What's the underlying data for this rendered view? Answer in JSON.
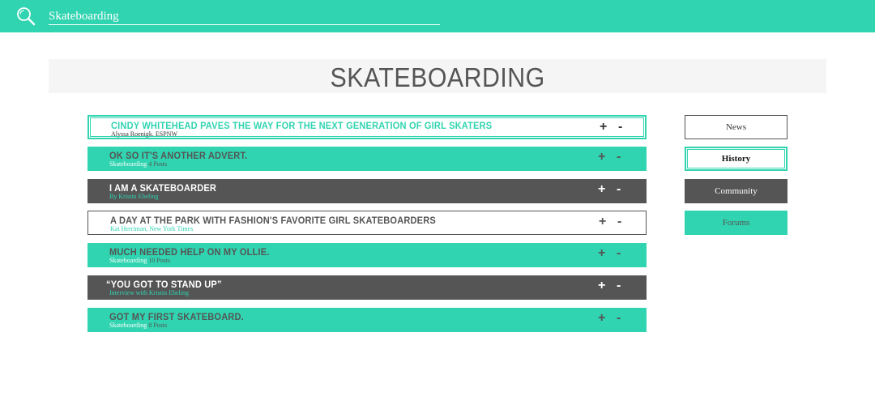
{
  "search": {
    "value": "Skateboarding"
  },
  "page": {
    "title": "SKATEBOARDING"
  },
  "feed": [
    {
      "title": "CINDY WHITEHEAD PAVES THE WAY FOR THE NEXT GENERATION OF GIRL SKATERS",
      "sub": "Alyssa Roenigk, ESPNW",
      "count": "",
      "style": "outline-teal"
    },
    {
      "title": "OK SO IT'S ANOTHER ADVERT.",
      "sub": "Skateboarding",
      "count": "4 Posts",
      "style": "teal"
    },
    {
      "title": "I AM A SKATEBOARDER",
      "sub": "By Kristin Ebeling",
      "count": "",
      "style": "dark"
    },
    {
      "title": "A DAY AT THE PARK WITH FASHION'S FAVORITE GIRL SKATEBOARDERS",
      "sub": "Kat Herriman, New York Times",
      "count": "",
      "style": "outline-gray"
    },
    {
      "title": "MUCH NEEDED HELP ON MY OLLIE.",
      "sub": "Skateboarding",
      "count": "10 Posts",
      "style": "teal"
    },
    {
      "title": "“YOU GOT TO STAND UP”",
      "sub": "Interview with Kristin Ebeling",
      "count": "",
      "style": "dark"
    },
    {
      "title": "GOT MY FIRST SKATEBOARD.",
      "sub": "Skateboarding",
      "count": "8 Posts",
      "style": "teal"
    }
  ],
  "controls": {
    "plus": "+",
    "minus": "-"
  },
  "nav": [
    {
      "label": "News",
      "style": "outline-dark"
    },
    {
      "label": "History",
      "style": "double-teal"
    },
    {
      "label": "Community",
      "style": "dark"
    },
    {
      "label": "Forums",
      "style": "teal"
    }
  ],
  "colors": {
    "accent": "#30d4b0",
    "dark": "#555555",
    "title_band": "#f5f5f5"
  },
  "icons": {
    "search": "search-icon"
  }
}
